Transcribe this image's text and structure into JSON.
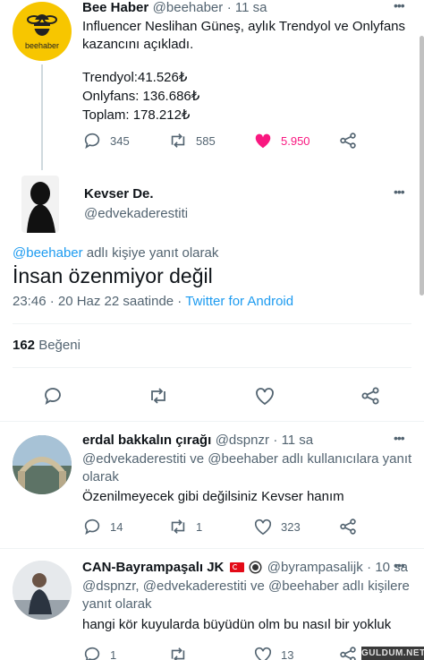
{
  "tweet1": {
    "avatar_text": "beehaber",
    "name": "Bee Haber",
    "handle": "@beehaber",
    "time": "· 11 sa",
    "body_line1": "Influencer Neslihan Güneş, aylık Trendyol ve Onlyfans",
    "body_line2": "kazancını açıkladı.",
    "stat1": "Trendyol:41.526₺",
    "stat2": "Onlyfans: 136.686₺",
    "stat3": "Toplam: 178.212₺",
    "replies": "345",
    "retweets": "585",
    "likes": "5.950"
  },
  "tweet2": {
    "name": "Kevser De.",
    "handle": "@edvekaderestiti",
    "reply_to_handle": "@beehaber",
    "reply_to_suffix": "adlı kişiye yanıt olarak",
    "body": "İnsan özenmiyor değil",
    "time_date": "23:46 · 20 Haz 22 saatinde ·",
    "client": "Twitter for Android",
    "likes_count": "162",
    "likes_label": "Beğeni"
  },
  "reply1": {
    "name": "erdal bakkalın çırağı",
    "handle": "@dspnzr",
    "time": "· 11 sa",
    "reply_line1": "@edvekaderestiti ve @beehaber adlı kullanıcılara yanıt",
    "reply_line2": "olarak",
    "body": "Özenilmeyecek gibi değilsiniz Kevser hanım",
    "replies": "14",
    "retweets": "1",
    "likes": "323"
  },
  "reply2": {
    "name": "CAN-Bayrampaşalı JK",
    "handle": "@byrampasalijk",
    "time": "· 10 sa",
    "reply_line1": "@dspnzr, @edvekaderestiti ve @beehaber adlı kişilere",
    "reply_line2": "yanıt olarak",
    "body": "hangi kör kuyularda büyüdün olm bu nasıl bir yokluk",
    "replies": "1",
    "likes": "13"
  },
  "watermark": "GULDUM.NET",
  "colors": {
    "accent": "#1d9bf0",
    "like_pink": "#f91880",
    "bee_yellow": "#f7c600"
  }
}
